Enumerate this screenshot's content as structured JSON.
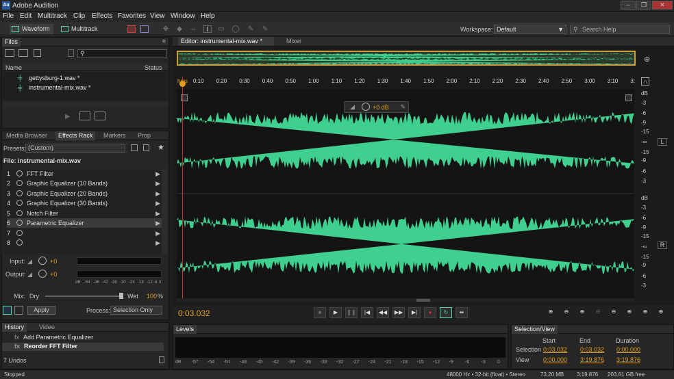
{
  "titlebar": {
    "logo": "Au",
    "title": "Adobe Audition",
    "min": "‒",
    "max": "❐",
    "close": "✕"
  },
  "menu": [
    "File",
    "Edit",
    "Multitrack",
    "Clip",
    "Effects",
    "Favorites",
    "View",
    "Window",
    "Help"
  ],
  "toolbar": {
    "waveform": "Waveform",
    "multitrack": "Multitrack",
    "workspace_label": "Workspace:",
    "workspace_value": "Default",
    "search_placeholder": "Search Help"
  },
  "files": {
    "tab": "Files",
    "col_name": "Name",
    "col_status": "Status",
    "items": [
      "gettysburg-1.wav *",
      "instrumental-mix.wav *"
    ]
  },
  "effects": {
    "tabs": [
      "Media Browser",
      "Effects Rack",
      "Markers",
      "Prop"
    ],
    "presets_label": "Presets:",
    "preset_value": "(Custom)",
    "file_label": "File: instrumental-mix.wav",
    "rack": [
      {
        "n": "1",
        "name": "FFT Filter"
      },
      {
        "n": "2",
        "name": "Graphic Equalizer (10 Bands)"
      },
      {
        "n": "3",
        "name": "Graphic Equalizer (20 Bands)"
      },
      {
        "n": "4",
        "name": "Graphic Equalizer (30 Bands)"
      },
      {
        "n": "5",
        "name": "Notch Filter"
      },
      {
        "n": "6",
        "name": "Parametric Equalizer"
      },
      {
        "n": "7",
        "name": ""
      },
      {
        "n": "8",
        "name": ""
      }
    ],
    "input_label": "Input:",
    "input_val": "+0",
    "output_label": "Output:",
    "output_val": "+0",
    "mix_label": "Mix:",
    "dry": "Dry",
    "wet": "Wet",
    "wet_val": "100",
    "wet_unit": "%",
    "apply": "Apply",
    "process_label": "Process:",
    "process_value": "Selection Only",
    "meter_ticks": [
      "dB",
      "-54",
      "-48",
      "-42",
      "-36",
      "-30",
      "-24",
      "-18",
      "-12",
      "-6",
      "0"
    ]
  },
  "history": {
    "tabs": [
      "History",
      "Video"
    ],
    "items": [
      "Add Parametric Equalizer",
      "Reorder FFT Filter"
    ],
    "undos": "7 Undos"
  },
  "editor": {
    "tab": "Editor: instrumental-mix.wav *",
    "mixer": "Mixer",
    "hud_val": "+0 dB",
    "ticks": [
      "hms",
      "0:10",
      "0:20",
      "0:30",
      "0:40",
      "0:50",
      "1:00",
      "1:10",
      "1:20",
      "1:30",
      "1:40",
      "1:50",
      "2:00",
      "2:10",
      "2:20",
      "2:30",
      "2:40",
      "2:50",
      "3:00",
      "3:10",
      "3:"
    ],
    "db_labels": [
      "dB",
      "-3",
      "-6",
      "-9",
      "-15",
      "-∞",
      "-15",
      "-9",
      "-6",
      "-3"
    ],
    "ch_left": "L",
    "ch_right": "R"
  },
  "transport": {
    "time": "0:03.032"
  },
  "levels": {
    "tab": "Levels",
    "ticks": [
      "dB",
      "-57",
      "-54",
      "-51",
      "-48",
      "-45",
      "-42",
      "-39",
      "-36",
      "-33",
      "-30",
      "-27",
      "-24",
      "-21",
      "-18",
      "-15",
      "-12",
      "-9",
      "-6",
      "-3",
      "0"
    ]
  },
  "selview": {
    "tab": "Selection/View",
    "h_start": "Start",
    "h_end": "End",
    "h_dur": "Duration",
    "r_sel": "Selection",
    "r_view": "View",
    "sel_start": "0:03.032",
    "sel_end": "0:03.032",
    "sel_dur": "0:00.000",
    "view_start": "0:00.000",
    "view_end": "3:19.876",
    "view_dur": "3:19.876"
  },
  "status": {
    "left": "Stopped",
    "rate": "48000 Hz • 32-bit (float) • Stereo",
    "size": "73.20 MB",
    "dur": "3:19.876",
    "free": "203.61 GB free"
  },
  "colors": {
    "wave": "#3fcf8e",
    "accent": "#e0a020",
    "playhead": "#c83030"
  }
}
